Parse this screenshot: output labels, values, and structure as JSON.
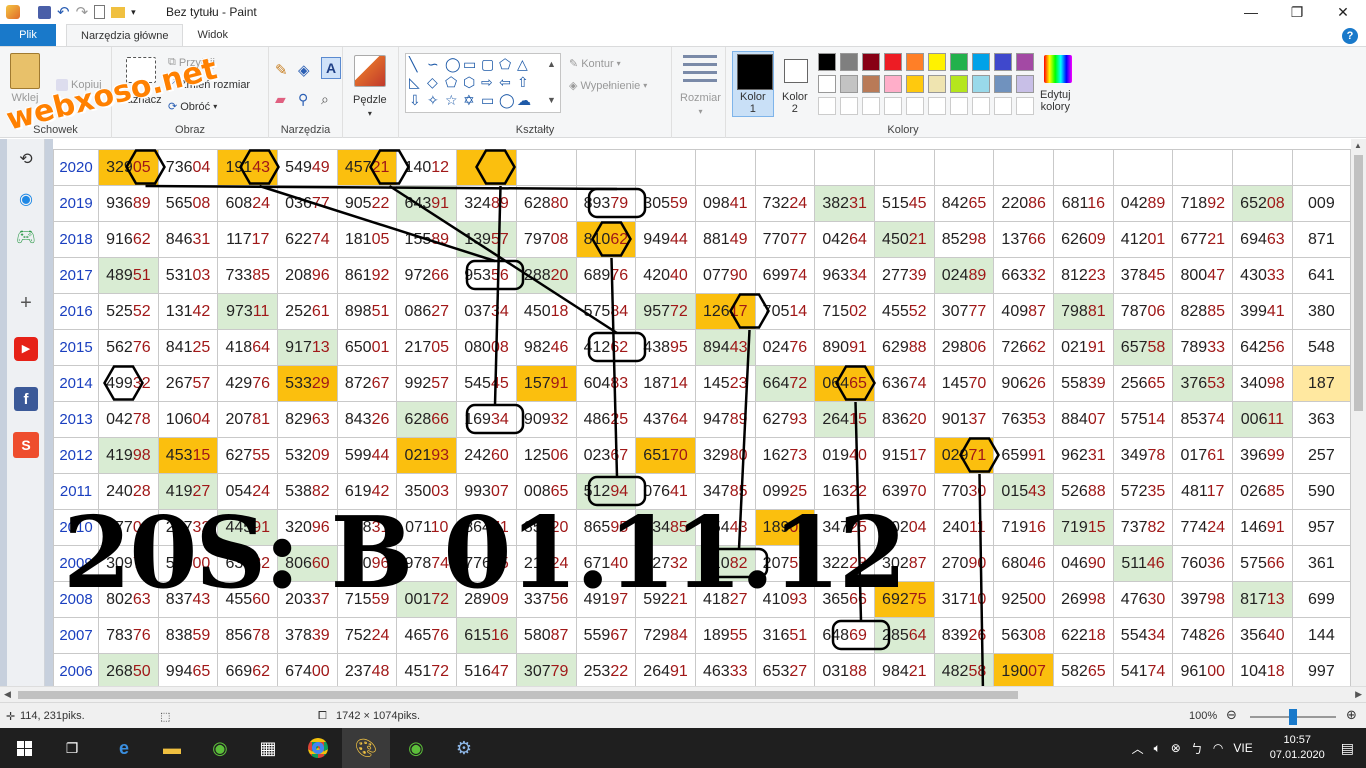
{
  "app": {
    "title": "Bez tytułu - Paint"
  },
  "tabs": [
    {
      "label": "Plik"
    },
    {
      "label": "Narzędzia główne"
    },
    {
      "label": "Widok"
    }
  ],
  "ribbon": {
    "clipboard": {
      "group": "Schowek",
      "paste": "Wklej",
      "copy": "Kopiuj"
    },
    "image": {
      "group": "Obraz",
      "select": "Zaznacz",
      "crop": "Przytnij",
      "resize": "Zmień rozmiar",
      "rotate": "Obróć"
    },
    "tools": {
      "group": "Narzędzia"
    },
    "brushes": {
      "label": "Pędzle"
    },
    "shapes": {
      "group": "Kształty",
      "outline": "Kontur",
      "fill": "Wypełnienie"
    },
    "size": {
      "label": "Rozmiar"
    },
    "colors": {
      "group": "Kolory",
      "color1_l1": "Kolor",
      "color1_l2": "1",
      "color2_l1": "Kolor",
      "color2_l2": "2",
      "edit_l1": "Edytuj",
      "edit_l2": "kolory",
      "color1": "#000000",
      "color2": "#ffffff",
      "palette_row1": [
        "#000000",
        "#7f7f7f",
        "#880015",
        "#ed1c24",
        "#ff7f27",
        "#fff200",
        "#22b14c",
        "#00a2e8",
        "#3f48cc",
        "#a349a4"
      ],
      "palette_row2": [
        "#ffffff",
        "#c3c3c3",
        "#b97a57",
        "#ffaec9",
        "#ffc90e",
        "#efe4b0",
        "#b5e61d",
        "#99d9ea",
        "#7092be",
        "#c8bfe7"
      ]
    }
  },
  "watermark": "webxoso.net",
  "overlay_text": "20S: B 01.11.12",
  "grid": {
    "rows": [
      {
        "year": "2020",
        "cells": [
          "32905",
          "73604",
          "19143",
          "54949",
          "45721",
          "14012",
          "",
          "",
          "",
          "",
          "",
          "",
          "",
          "",
          "",
          "",
          "",
          "",
          "",
          "",
          ""
        ]
      },
      {
        "year": "2019",
        "cells": [
          "93689",
          "56508",
          "60824",
          "03677",
          "90522",
          "64391",
          "32489",
          "62880",
          "89379",
          "30559",
          "09841",
          "73224",
          "38231",
          "51545",
          "84265",
          "22086",
          "68116",
          "04289",
          "71892",
          "65208",
          "009"
        ]
      },
      {
        "year": "2018",
        "cells": [
          "91662",
          "84631",
          "11717",
          "62274",
          "18105",
          "15589",
          "13957",
          "79708",
          "81062",
          "94944",
          "88149",
          "77077",
          "04264",
          "45021",
          "85298",
          "13766",
          "62609",
          "41201",
          "67721",
          "69463",
          "871"
        ]
      },
      {
        "year": "2017",
        "cells": [
          "48951",
          "53103",
          "73385",
          "20896",
          "86192",
          "97266",
          "95356",
          "28820",
          "68976",
          "42040",
          "07790",
          "69974",
          "96334",
          "27739",
          "02489",
          "66332",
          "81223",
          "37845",
          "80047",
          "43033",
          "641"
        ]
      },
      {
        "year": "2016",
        "cells": [
          "52552",
          "13142",
          "97311",
          "25261",
          "89851",
          "08627",
          "03734",
          "45018",
          "57584",
          "95772",
          "12617",
          "70514",
          "71502",
          "45552",
          "30777",
          "40987",
          "79881",
          "78706",
          "82885",
          "39941",
          "380"
        ]
      },
      {
        "year": "2015",
        "cells": [
          "56276",
          "84125",
          "41864",
          "91713",
          "65001",
          "21705",
          "08008",
          "98246",
          "41262",
          "43895",
          "89443",
          "02476",
          "89091",
          "62988",
          "29806",
          "72662",
          "02191",
          "65758",
          "78933",
          "64256",
          "548"
        ]
      },
      {
        "year": "2014",
        "cells": [
          "49932",
          "26757",
          "42976",
          "53329",
          "87267",
          "99257",
          "54545",
          "15791",
          "60483",
          "18714",
          "14523",
          "66472",
          "06465",
          "63674",
          "14570",
          "90626",
          "55839",
          "25665",
          "37653",
          "34098",
          "187"
        ]
      },
      {
        "year": "2013",
        "cells": [
          "04278",
          "10604",
          "20781",
          "82963",
          "84326",
          "62866",
          "16934",
          "90932",
          "48625",
          "43764",
          "94789",
          "62793",
          "26415",
          "83620",
          "90137",
          "76353",
          "88407",
          "57514",
          "85374",
          "00611",
          "363"
        ]
      },
      {
        "year": "2012",
        "cells": [
          "41998",
          "45315",
          "62755",
          "53209",
          "59944",
          "02193",
          "24260",
          "12506",
          "02367",
          "65170",
          "32980",
          "16273",
          "01940",
          "91517",
          "02971",
          "65991",
          "96231",
          "34978",
          "01761",
          "39699",
          "257"
        ]
      },
      {
        "year": "2011",
        "cells": [
          "24028",
          "41927",
          "05424",
          "53882",
          "61942",
          "35003",
          "99307",
          "00865",
          "51294",
          "07641",
          "34785",
          "09925",
          "16322",
          "63970",
          "77030",
          "01543",
          "52688",
          "57235",
          "48117",
          "02685",
          "590"
        ]
      },
      {
        "year": "2010",
        "cells": [
          "87704",
          "22732",
          "44591",
          "32096",
          "65831",
          "07110",
          "86471",
          "85720",
          "86595",
          "53485",
          "25443",
          "18902",
          "34725",
          "80204",
          "24011",
          "71916",
          "71915",
          "73782",
          "77424",
          "14691",
          "957"
        ]
      },
      {
        "year": "2009",
        "cells": [
          "30972",
          "56600",
          "63582",
          "80660",
          "56096",
          "97874",
          "77615",
          "21524",
          "67140",
          "42732",
          "61082",
          "20757",
          "32223",
          "30287",
          "27090",
          "68046",
          "04690",
          "51146",
          "76036",
          "57566",
          "361"
        ]
      },
      {
        "year": "2008",
        "cells": [
          "80263",
          "83743",
          "45560",
          "20337",
          "71559",
          "00172",
          "28909",
          "33756",
          "49197",
          "59221",
          "41827",
          "41093",
          "36566",
          "69275",
          "31710",
          "92500",
          "26998",
          "47630",
          "39798",
          "81713",
          "699"
        ]
      },
      {
        "year": "2007",
        "cells": [
          "78376",
          "83859",
          "85678",
          "37839",
          "75224",
          "46576",
          "61516",
          "58087",
          "55967",
          "72984",
          "18955",
          "31651",
          "64869",
          "28564",
          "83926",
          "56308",
          "62218",
          "55434",
          "74826",
          "35640",
          "144"
        ]
      },
      {
        "year": "2006",
        "cells": [
          "26850",
          "99465",
          "66962",
          "67400",
          "23748",
          "45172",
          "51647",
          "30779",
          "25322",
          "26491",
          "46333",
          "65327",
          "03188",
          "98421",
          "48258",
          "19007",
          "58265",
          "54174",
          "96100",
          "10418",
          "997"
        ]
      }
    ]
  },
  "status": {
    "cursor": "114, 231piks.",
    "size": "1742 × 1074piks.",
    "zoom": "100%"
  },
  "taskbar": {
    "lang": "VIE",
    "time": "10:57",
    "date": "07.01.2020"
  }
}
